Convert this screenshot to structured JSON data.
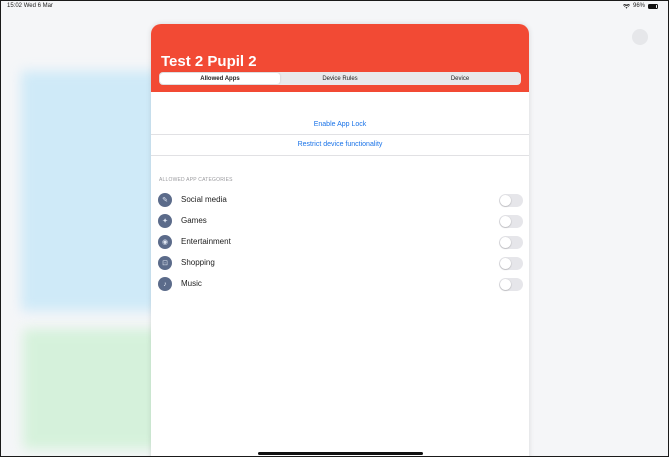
{
  "status_bar": {
    "time": "15:02",
    "date": "Wed 6 Mar",
    "battery": "96%"
  },
  "sheet": {
    "title": "Test 2 Pupil 2",
    "tabs": [
      {
        "label": "Allowed Apps",
        "active": true
      },
      {
        "label": "Device Rules",
        "active": false
      },
      {
        "label": "Device",
        "active": false
      }
    ],
    "actions": {
      "enable_lock": "Enable App Lock",
      "restrict": "Restrict device functionality"
    },
    "section_header": "ALLOWED APP CATEGORIES",
    "categories": [
      {
        "label": "Social media",
        "icon": "social-media-icon",
        "enabled": false
      },
      {
        "label": "Games",
        "icon": "games-icon",
        "enabled": false
      },
      {
        "label": "Entertainment",
        "icon": "entertainment-icon",
        "enabled": false
      },
      {
        "label": "Shopping",
        "icon": "shopping-icon",
        "enabled": false
      },
      {
        "label": "Music",
        "icon": "music-icon",
        "enabled": false
      }
    ]
  },
  "colors": {
    "header_red": "#f24a34",
    "link_blue": "#1a73e8",
    "icon_slate": "#5b6b8a"
  }
}
